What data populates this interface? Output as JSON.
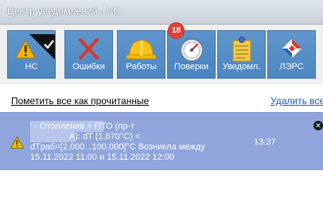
{
  "window": {
    "title": "Центр уведомлений - НС"
  },
  "toolbar": {
    "items": [
      {
        "label": "НС",
        "icon": "warning-check-icon"
      },
      {
        "label": "Ошибки",
        "icon": "red-x-icon"
      },
      {
        "label": "Работы",
        "icon": "hard-hat-icon"
      },
      {
        "label": "Поверки",
        "icon": "gauge-icon",
        "badge": "18"
      },
      {
        "label": "Уведомл.",
        "icon": "notepad-pin-icon"
      },
      {
        "label": "ЛЭРС",
        "icon": "lers-logo-icon"
      }
    ]
  },
  "actions": {
    "mark_all_read": "Пометить все как прочитанные",
    "delete_all": "Удалить все"
  },
  "notification": {
    "text": "' - Отопление + ПТО (пр-т\n                А): dT (1,670°C) <\ndTраб=[2,000...100,000]°C Возникла между\n15.11.2022 11:00 и 15.11.2022 12:00",
    "time": "13:37"
  },
  "colors": {
    "toolbar_button": "#4d86c2",
    "notification_bg": "#8fa5dc",
    "badge": "#e0403a",
    "link": "#1a56c9"
  }
}
